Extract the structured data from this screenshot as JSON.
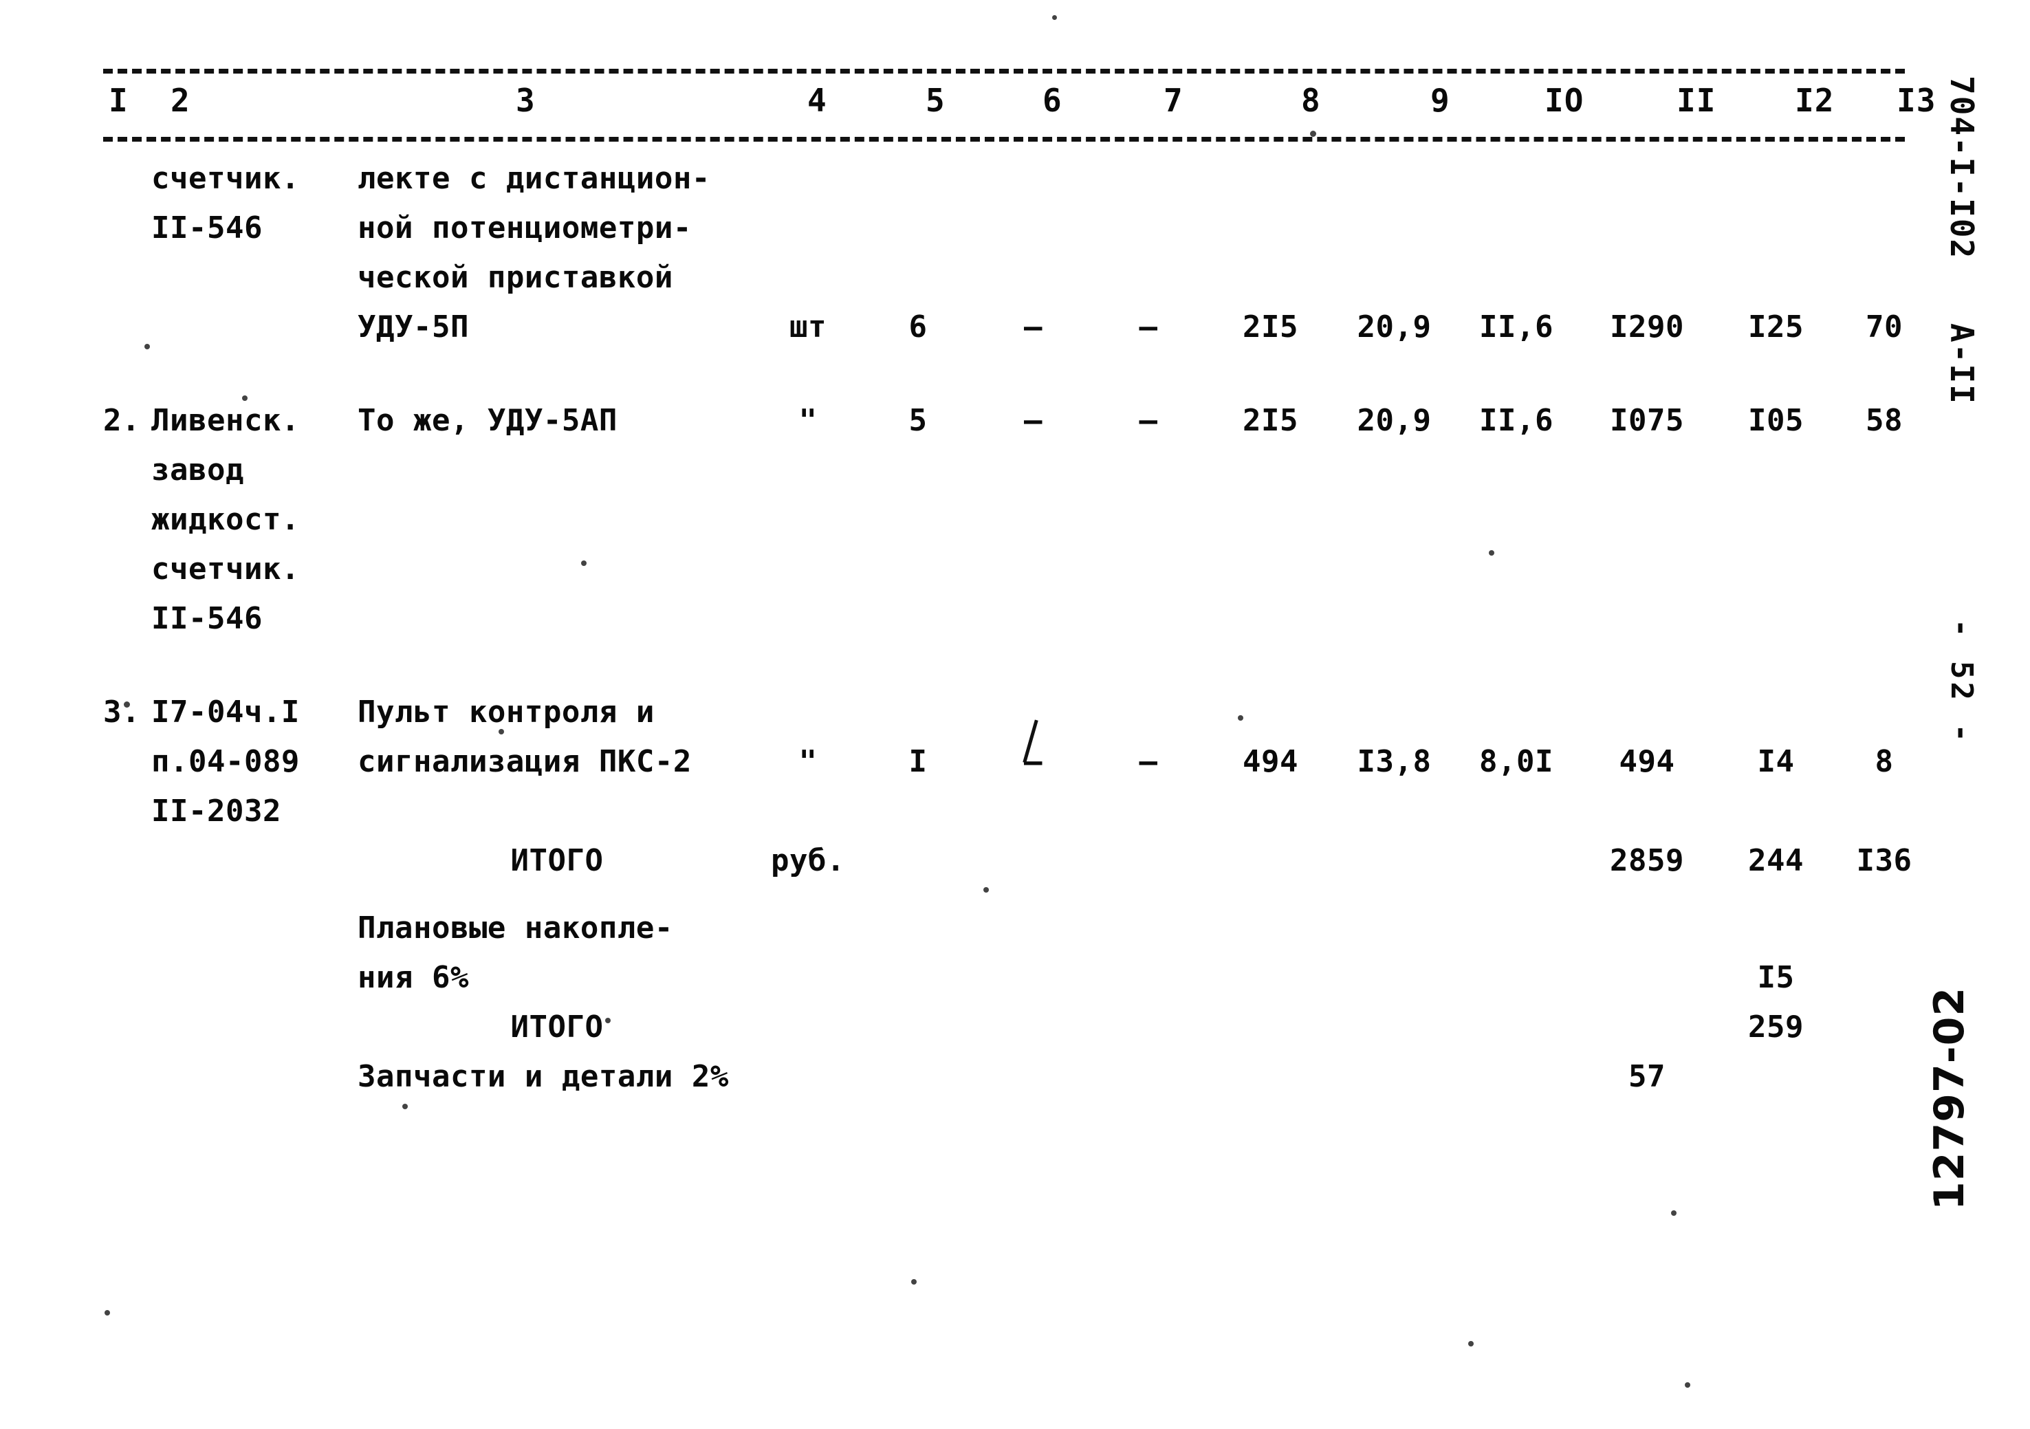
{
  "document": {
    "sheet_code": "704-I-I02",
    "sheet_series": "А-II",
    "page_number": "- 52 -",
    "stamp": "12797-02"
  },
  "table": {
    "column_numbers": [
      "I",
      "2",
      "3",
      "4",
      "5",
      "6",
      "7",
      "8",
      "9",
      "IO",
      "II",
      "I2",
      "I3"
    ],
    "rows": [
      {
        "no": "",
        "code": "счетчик.",
        "code2": "II-546",
        "name_lines": [
          "лекте с дистанцион-",
          "ной потенциометри-",
          "ческой приставкой",
          "УДУ-5П"
        ],
        "unit": "шт",
        "c5": "6",
        "c6": "–",
        "c7": "–",
        "c8": "2I5",
        "c9": "20,9",
        "c10": "II,6",
        "c11": "I290",
        "c12": "I25",
        "c13": "70"
      },
      {
        "no": "2.",
        "code": "Ливенск.",
        "code_lines": [
          "Ливенск.",
          "завод",
          "жидкост.",
          "счетчик.",
          "II-546"
        ],
        "name_lines": [
          "То же, УДУ-5АП"
        ],
        "unit": "\"",
        "c5": "5",
        "c6": "–",
        "c7": "–",
        "c8": "2I5",
        "c9": "20,9",
        "c10": "II,6",
        "c11": "I075",
        "c12": "I05",
        "c13": "58"
      },
      {
        "no": "3.",
        "code": "I7-04ч.I",
        "code_lines": [
          "I7-04ч.I",
          "п.04-089",
          "II-2032"
        ],
        "name_lines": [
          "Пульт контроля и",
          "сигнализация ПКС-2"
        ],
        "unit": "\"",
        "c5": "I",
        "c6": "–",
        "c7": "–",
        "c8": "494",
        "c9": "I3,8",
        "c10": "8,0I",
        "c11": "494",
        "c12": "I4",
        "c13": "8"
      }
    ],
    "summary": [
      {
        "label": "ИТОГО",
        "unit": "руб.",
        "c11": "2859",
        "c12": "244",
        "c13": "I36"
      },
      {
        "label_lines": [
          "Плановые накопле-",
          "ния 6%"
        ],
        "unit": "",
        "c11": "",
        "c12": "I5",
        "c13": ""
      },
      {
        "label": "ИТОГО",
        "unit": "",
        "c11": "",
        "c12": "259",
        "c13": ""
      },
      {
        "label": "Запчасти и детали 2%",
        "unit": "",
        "c11": "57",
        "c12": "",
        "c13": ""
      }
    ]
  }
}
